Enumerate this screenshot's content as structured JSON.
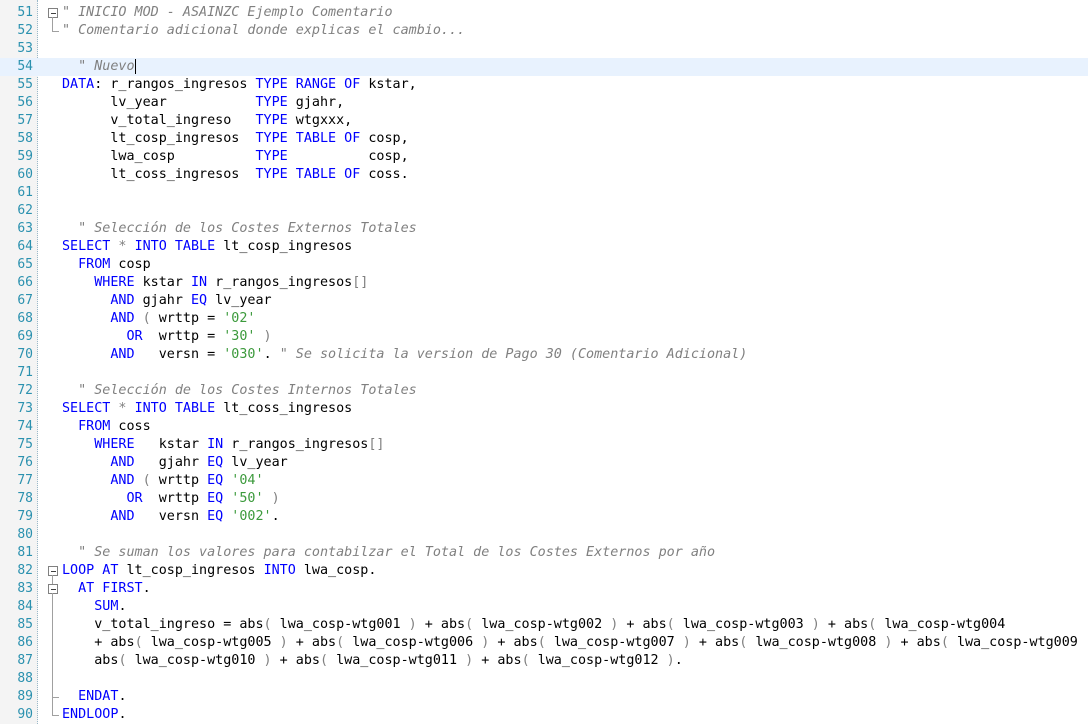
{
  "editor": {
    "current_line": 54,
    "lines": [
      {
        "n": "51",
        "fold": "open",
        "t": [
          [
            "cm",
            "\" INICIO MOD - ASAINZC Ejemplo Comentario"
          ]
        ]
      },
      {
        "n": "52",
        "fold": "end",
        "t": [
          [
            "cm",
            "\" Comentario adicional donde explicas el cambio..."
          ]
        ]
      },
      {
        "n": "53",
        "t": []
      },
      {
        "n": "54",
        "caret": true,
        "t": [
          [
            "cm",
            "  \" Nuevo"
          ]
        ]
      },
      {
        "n": "55",
        "t": [
          [
            "kw",
            "DATA"
          ],
          [
            "id",
            ": r_rangos_ingresos "
          ],
          [
            "kw",
            "TYPE RANGE OF"
          ],
          [
            "id",
            " kstar,"
          ]
        ]
      },
      {
        "n": "56",
        "t": [
          [
            "id",
            "      lv_year           "
          ],
          [
            "kw",
            "TYPE"
          ],
          [
            "id",
            " gjahr,"
          ]
        ]
      },
      {
        "n": "57",
        "t": [
          [
            "id",
            "      v_total_ingreso   "
          ],
          [
            "kw",
            "TYPE"
          ],
          [
            "id",
            " wtgxxx,"
          ]
        ]
      },
      {
        "n": "58",
        "t": [
          [
            "id",
            "      lt_cosp_ingresos  "
          ],
          [
            "kw",
            "TYPE TABLE OF"
          ],
          [
            "id",
            " cosp,"
          ]
        ]
      },
      {
        "n": "59",
        "t": [
          [
            "id",
            "      lwa_cosp          "
          ],
          [
            "kw",
            "TYPE"
          ],
          [
            "id",
            "          cosp,"
          ]
        ]
      },
      {
        "n": "60",
        "t": [
          [
            "id",
            "      lt_coss_ingresos  "
          ],
          [
            "kw",
            "TYPE TABLE OF"
          ],
          [
            "id",
            " coss."
          ]
        ]
      },
      {
        "n": "61",
        "t": []
      },
      {
        "n": "62",
        "t": []
      },
      {
        "n": "63",
        "t": [
          [
            "cm",
            "  \" Selección de los Costes Externos Totales"
          ]
        ]
      },
      {
        "n": "64",
        "t": [
          [
            "kw",
            "SELECT"
          ],
          [
            "op",
            " * "
          ],
          [
            "kw",
            "INTO TABLE"
          ],
          [
            "id",
            " lt_cosp_ingresos"
          ]
        ]
      },
      {
        "n": "65",
        "t": [
          [
            "id",
            "  "
          ],
          [
            "kw",
            "FROM"
          ],
          [
            "id",
            " cosp"
          ]
        ]
      },
      {
        "n": "66",
        "t": [
          [
            "id",
            "    "
          ],
          [
            "kw",
            "WHERE"
          ],
          [
            "id",
            " kstar "
          ],
          [
            "kw",
            "IN"
          ],
          [
            "id",
            " r_rangos_ingresos"
          ],
          [
            "op",
            "[]"
          ]
        ]
      },
      {
        "n": "67",
        "t": [
          [
            "id",
            "      "
          ],
          [
            "kw",
            "AND"
          ],
          [
            "id",
            " gjahr "
          ],
          [
            "kw",
            "EQ"
          ],
          [
            "id",
            " lv_year"
          ]
        ]
      },
      {
        "n": "68",
        "t": [
          [
            "id",
            "      "
          ],
          [
            "kw",
            "AND"
          ],
          [
            "op",
            " ( "
          ],
          [
            "id",
            "wrttp = "
          ],
          [
            "st",
            "'02'"
          ]
        ]
      },
      {
        "n": "69",
        "t": [
          [
            "id",
            "        "
          ],
          [
            "kw",
            "OR"
          ],
          [
            "id",
            "  wrttp = "
          ],
          [
            "st",
            "'30'"
          ],
          [
            "op",
            " )"
          ]
        ]
      },
      {
        "n": "70",
        "t": [
          [
            "id",
            "      "
          ],
          [
            "kw",
            "AND"
          ],
          [
            "id",
            "   versn = "
          ],
          [
            "st",
            "'030'"
          ],
          [
            "id",
            ". "
          ],
          [
            "cm",
            "\" Se solicita la version de Pago 30 (Comentario Adicional)"
          ]
        ]
      },
      {
        "n": "71",
        "t": []
      },
      {
        "n": "72",
        "t": [
          [
            "cm",
            "  \" Selección de los Costes Internos Totales"
          ]
        ]
      },
      {
        "n": "73",
        "t": [
          [
            "kw",
            "SELECT"
          ],
          [
            "op",
            " * "
          ],
          [
            "kw",
            "INTO TABLE"
          ],
          [
            "id",
            " lt_coss_ingresos"
          ]
        ]
      },
      {
        "n": "74",
        "t": [
          [
            "id",
            "  "
          ],
          [
            "kw",
            "FROM"
          ],
          [
            "id",
            " coss"
          ]
        ]
      },
      {
        "n": "75",
        "t": [
          [
            "id",
            "    "
          ],
          [
            "kw",
            "WHERE"
          ],
          [
            "id",
            "   kstar "
          ],
          [
            "kw",
            "IN"
          ],
          [
            "id",
            " r_rangos_ingresos"
          ],
          [
            "op",
            "[]"
          ]
        ]
      },
      {
        "n": "76",
        "t": [
          [
            "id",
            "      "
          ],
          [
            "kw",
            "AND"
          ],
          [
            "id",
            "   gjahr "
          ],
          [
            "kw",
            "EQ"
          ],
          [
            "id",
            " lv_year"
          ]
        ]
      },
      {
        "n": "77",
        "t": [
          [
            "id",
            "      "
          ],
          [
            "kw",
            "AND"
          ],
          [
            "op",
            " ( "
          ],
          [
            "id",
            "wrttp "
          ],
          [
            "kw",
            "EQ"
          ],
          [
            "st",
            " '04'"
          ]
        ]
      },
      {
        "n": "78",
        "t": [
          [
            "id",
            "        "
          ],
          [
            "kw",
            "OR"
          ],
          [
            "id",
            "  wrttp "
          ],
          [
            "kw",
            "EQ"
          ],
          [
            "st",
            " '50'"
          ],
          [
            "op",
            " )"
          ]
        ]
      },
      {
        "n": "79",
        "t": [
          [
            "id",
            "      "
          ],
          [
            "kw",
            "AND"
          ],
          [
            "id",
            "   versn "
          ],
          [
            "kw",
            "EQ"
          ],
          [
            "st",
            " '002'"
          ],
          [
            "id",
            "."
          ]
        ]
      },
      {
        "n": "80",
        "t": []
      },
      {
        "n": "81",
        "t": [
          [
            "cm",
            "  \" Se suman los valores para contabilzar el Total de los Costes Externos por año"
          ]
        ]
      },
      {
        "n": "82",
        "fold": "open",
        "t": [
          [
            "kw",
            "LOOP AT"
          ],
          [
            "id",
            " lt_cosp_ingresos "
          ],
          [
            "kw",
            "INTO"
          ],
          [
            "id",
            " lwa_cosp."
          ]
        ]
      },
      {
        "n": "83",
        "fold": "open2",
        "t": [
          [
            "id",
            "  "
          ],
          [
            "kw",
            "AT FIRST"
          ],
          [
            "id",
            "."
          ]
        ]
      },
      {
        "n": "84",
        "fold": "mid2",
        "t": [
          [
            "id",
            "    "
          ],
          [
            "kw",
            "SUM"
          ],
          [
            "id",
            "."
          ]
        ]
      },
      {
        "n": "85",
        "fold": "mid2",
        "t": [
          [
            "id",
            "    v_total_ingreso = abs"
          ],
          [
            "op",
            "( "
          ],
          [
            "id",
            "lwa_cosp-wtg001"
          ],
          [
            "op",
            " )"
          ],
          [
            "id",
            " + abs"
          ],
          [
            "op",
            "( "
          ],
          [
            "id",
            "lwa_cosp-wtg002"
          ],
          [
            "op",
            " )"
          ],
          [
            "id",
            " + abs"
          ],
          [
            "op",
            "( "
          ],
          [
            "id",
            "lwa_cosp-wtg003"
          ],
          [
            "op",
            " )"
          ],
          [
            "id",
            " + abs"
          ],
          [
            "op",
            "( "
          ],
          [
            "id",
            "lwa_cosp-wtg004"
          ]
        ]
      },
      {
        "n": "86",
        "fold": "mid2",
        "t": [
          [
            "id",
            "    + abs"
          ],
          [
            "op",
            "( "
          ],
          [
            "id",
            "lwa_cosp-wtg005"
          ],
          [
            "op",
            " )"
          ],
          [
            "id",
            " + abs"
          ],
          [
            "op",
            "( "
          ],
          [
            "id",
            "lwa_cosp-wtg006"
          ],
          [
            "op",
            " )"
          ],
          [
            "id",
            " + abs"
          ],
          [
            "op",
            "( "
          ],
          [
            "id",
            "lwa_cosp-wtg007"
          ],
          [
            "op",
            " )"
          ],
          [
            "id",
            " + abs"
          ],
          [
            "op",
            "( "
          ],
          [
            "id",
            "lwa_cosp-wtg008"
          ],
          [
            "op",
            " )"
          ],
          [
            "id",
            " + abs"
          ],
          [
            "op",
            "( "
          ],
          [
            "id",
            "lwa_cosp-wtg009"
          ]
        ]
      },
      {
        "n": "87",
        "fold": "mid2",
        "t": [
          [
            "id",
            "    abs"
          ],
          [
            "op",
            "( "
          ],
          [
            "id",
            "lwa_cosp-wtg010"
          ],
          [
            "op",
            " )"
          ],
          [
            "id",
            " + abs"
          ],
          [
            "op",
            "( "
          ],
          [
            "id",
            "lwa_cosp-wtg011"
          ],
          [
            "op",
            " )"
          ],
          [
            "id",
            " + abs"
          ],
          [
            "op",
            "( "
          ],
          [
            "id",
            "lwa_cosp-wtg012"
          ],
          [
            "op",
            " )"
          ],
          [
            "id",
            "."
          ]
        ]
      },
      {
        "n": "88",
        "fold": "mid2",
        "t": []
      },
      {
        "n": "89",
        "fold": "end2",
        "t": [
          [
            "id",
            "  "
          ],
          [
            "kw",
            "ENDAT"
          ],
          [
            "id",
            "."
          ]
        ]
      },
      {
        "n": "90",
        "fold": "end",
        "t": [
          [
            "kw",
            "ENDLOOP"
          ],
          [
            "id",
            "."
          ]
        ]
      }
    ]
  }
}
